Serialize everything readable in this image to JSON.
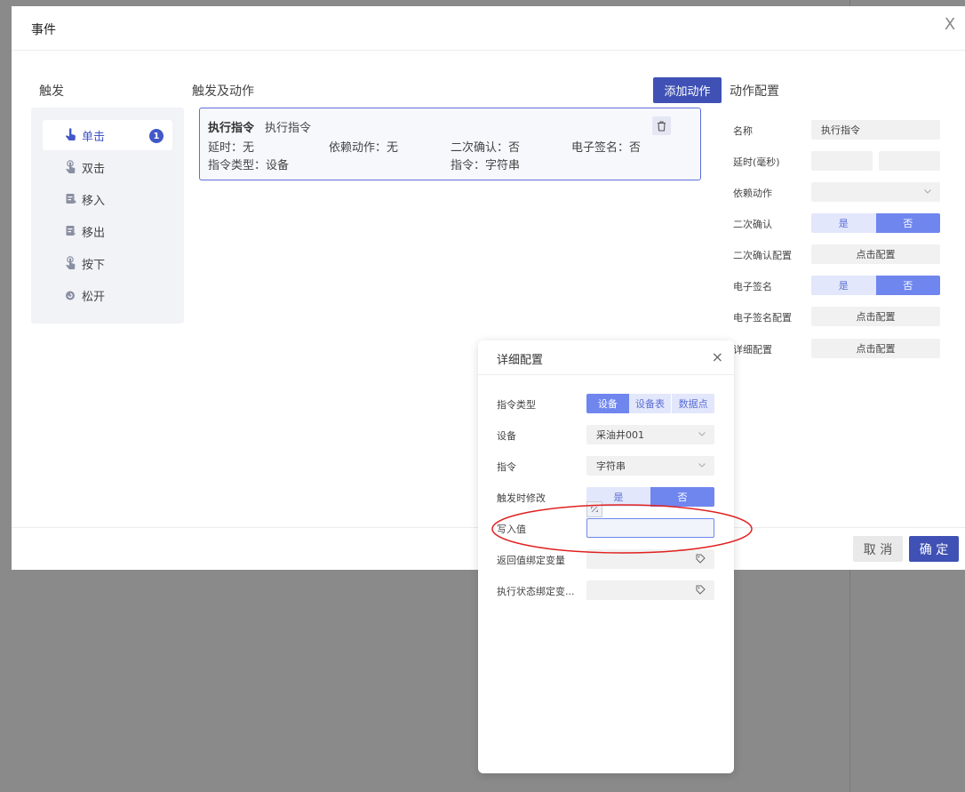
{
  "dialog": {
    "title": "事件",
    "close_symbol": "X"
  },
  "trigger": {
    "title": "触发",
    "items": [
      {
        "label": "单击",
        "badge": "1"
      },
      {
        "label": "双击"
      },
      {
        "label": "移入"
      },
      {
        "label": "移出"
      },
      {
        "label": "按下"
      },
      {
        "label": "松开"
      }
    ]
  },
  "actions": {
    "title": "触发及动作",
    "add_label": "添加动作",
    "card": {
      "type_title": "执行指令",
      "name": "执行指令",
      "delay": "延时：无",
      "depend": "依赖动作：无",
      "confirm": "二次确认：否",
      "esign": "电子签名：否",
      "cmd_type": "指令类型：设备",
      "cmd": "指令：字符串"
    }
  },
  "config": {
    "title": "动作配置",
    "name_label": "名称",
    "name_value": "执行指令",
    "delay_label": "延时(毫秒)",
    "depend_label": "依赖动作",
    "confirm_label": "二次确认",
    "confirm_options": [
      "是",
      "否"
    ],
    "confirm_config_label": "二次确认配置",
    "esign_label": "电子签名",
    "esign_options": [
      "是",
      "否"
    ],
    "esign_config_label": "电子签名配置",
    "detail_label": "详细配置",
    "click_config": "点击配置"
  },
  "footer": {
    "cancel": "取 消",
    "ok": "确 定"
  },
  "popup": {
    "title": "详细配置",
    "close_symbol": "×",
    "cmd_type_label": "指令类型",
    "cmd_type_options": [
      "设备",
      "设备表",
      "数据点"
    ],
    "device_label": "设备",
    "device_value": "采油井001",
    "cmd_label": "指令",
    "cmd_value": "字符串",
    "modify_label": "触发时修改",
    "modify_options": [
      "是",
      "否"
    ],
    "write_label": "写入值",
    "write_value": "",
    "return_label": "返回值绑定变量",
    "status_label": "执行状态绑定变..."
  },
  "colors": {
    "accent": "#3f51b5",
    "segment_on": "#6f86ef",
    "segment_off": "#e3e7fb",
    "highlight": "#e02020"
  }
}
